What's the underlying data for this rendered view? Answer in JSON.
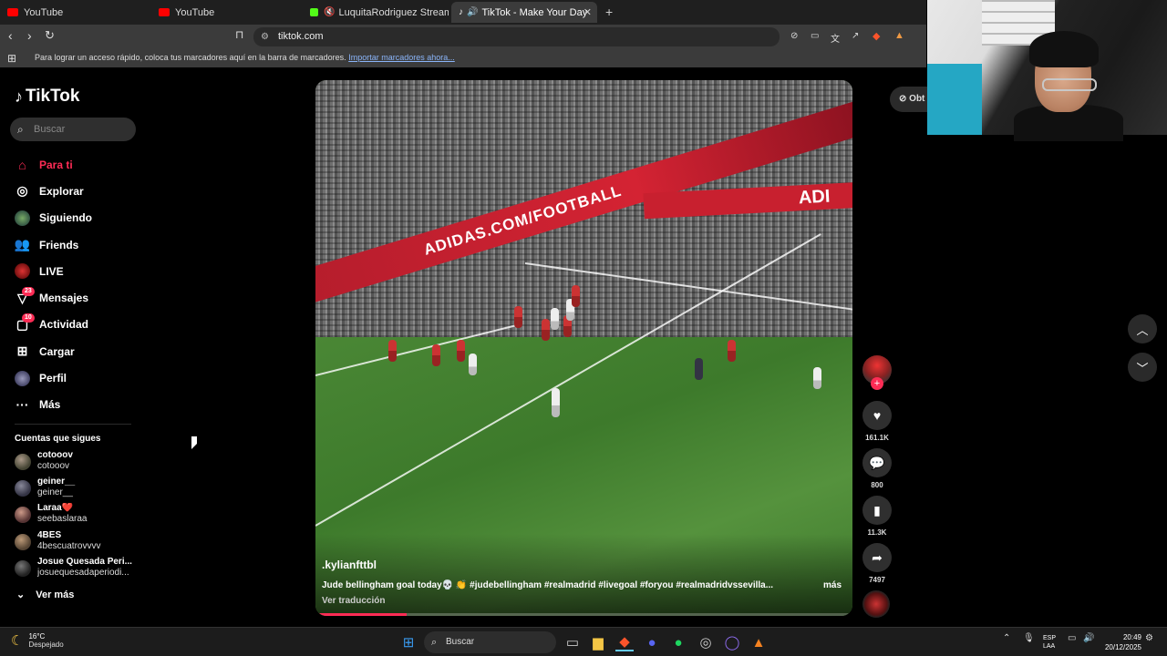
{
  "browser": {
    "tabs": [
      {
        "title": "YouTube",
        "color": "#ff0000",
        "active": false
      },
      {
        "title": "YouTube",
        "color": "#ff0000",
        "active": false
      },
      {
        "title": "LuquitaRodriguez Stream - Watc",
        "color": "#53fc18",
        "active": false
      },
      {
        "title": "TikTok - Make Your Day",
        "color": "#ffffff",
        "active": true
      }
    ],
    "url": "tiktok.com",
    "bookmarks_text": "Para lograr un acceso rápido, coloca tus marcadores aquí en la barra de marcadores.",
    "bookmarks_link": "Importar marcadores ahora..."
  },
  "tiktok": {
    "logo": "TikTok",
    "search_placeholder": "Buscar",
    "menu": [
      {
        "label": "Para ti",
        "icon": "home-icon",
        "active": true
      },
      {
        "label": "Explorar",
        "icon": "compass-icon"
      },
      {
        "label": "Siguiendo",
        "icon": "following-avatar-icon"
      },
      {
        "label": "Friends",
        "icon": "friends-icon"
      },
      {
        "label": "LIVE",
        "icon": "live-icon"
      },
      {
        "label": "Mensajes",
        "icon": "messages-icon",
        "badge": "23"
      },
      {
        "label": "Actividad",
        "icon": "activity-icon",
        "badge": "10"
      },
      {
        "label": "Cargar",
        "icon": "upload-icon"
      },
      {
        "label": "Perfil",
        "icon": "profile-avatar-icon"
      },
      {
        "label": "Más",
        "icon": "more-icon"
      }
    ],
    "following_title": "Cuentas que sigues",
    "following": [
      {
        "name": "cotooov",
        "user": "cotooov"
      },
      {
        "name": "geiner__",
        "user": "geiner__"
      },
      {
        "name": "Laraa❤️",
        "user": "seebaslaraa"
      },
      {
        "name": "4BES",
        "user": "4bescuatrovvvv"
      },
      {
        "name": "Josue Quesada Peri...",
        "user": "josuequesadaperiodi..."
      }
    ],
    "see_more": "Ver más",
    "video": {
      "author": ".kylianfttbl",
      "caption": "Jude bellingham goal today💀 👏 #judebellingham #realmadrid #livegoal #foryou #realmadridvssevilla...",
      "more": "más",
      "translate": "Ver traducción",
      "progress": 0.17,
      "ad_board": "ADIDAS.COM/FOOTBALL",
      "ad_board_right": "ADI"
    },
    "actions": {
      "likes": "161.1K",
      "comments": "800",
      "saves": "11.3K",
      "shares": "7497"
    },
    "get_app": "Obt"
  },
  "taskbar": {
    "temp": "16°C",
    "weather": "Despejado",
    "search": "Buscar",
    "lang1": "ESP",
    "lang2": "LAA",
    "time": "20:49",
    "date": "20/12/2025"
  }
}
